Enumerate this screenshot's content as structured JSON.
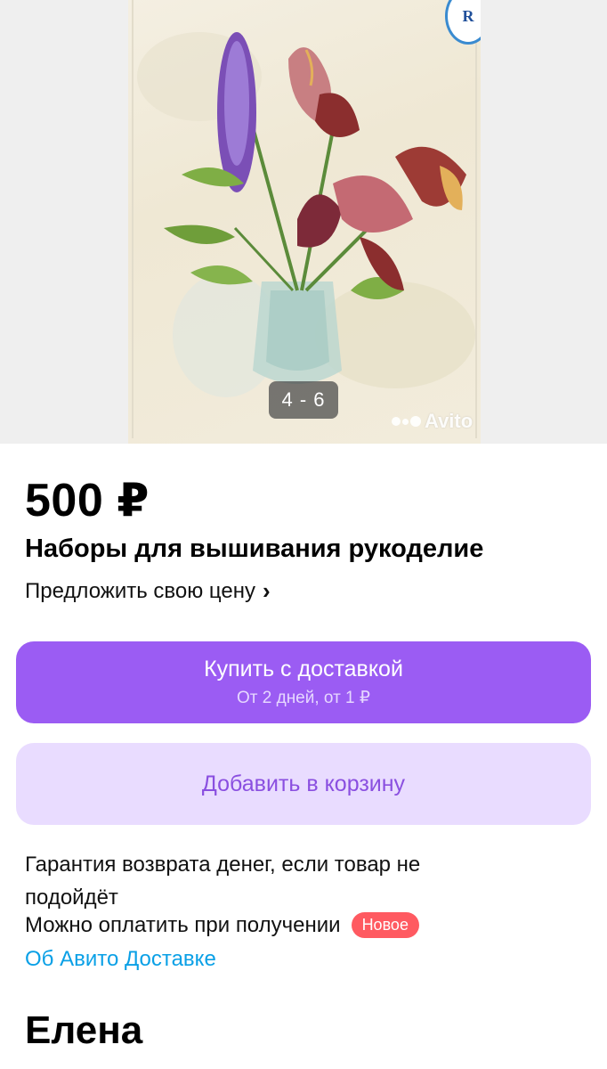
{
  "gallery": {
    "counter": "4 - 6",
    "watermark": "Avito",
    "seal_letter": "R"
  },
  "listing": {
    "price": "500 ₽",
    "title": "Наборы для вышивания рукоделие",
    "offer_price": "Предложить свою цену",
    "offer_chevron": "›"
  },
  "actions": {
    "buy_main": "Купить с доставкой",
    "buy_sub": "От 2 дней, от 1 ₽",
    "cart": "Добавить в корзину"
  },
  "info": {
    "guarantee": "Гарантия возврата денег, если товар не подойдёт",
    "pay_on_receipt": "Можно оплатить при получении",
    "new_badge": "Новое",
    "about_delivery": "Об Авито Доставке"
  },
  "seller": {
    "name": "Елена"
  },
  "colors": {
    "accent": "#9b5cf3",
    "accent_light": "#e9dcff",
    "link": "#0aa0e6",
    "badge": "#ff5a61"
  }
}
